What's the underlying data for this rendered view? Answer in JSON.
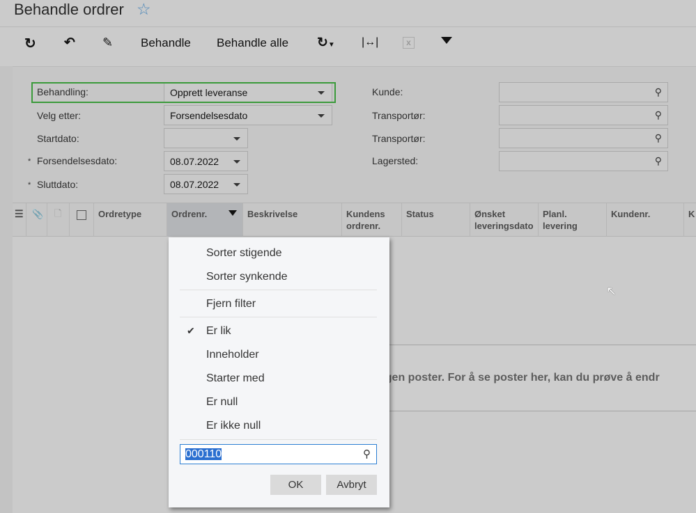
{
  "header": {
    "title": "Behandle ordrer",
    "favorite_icon": "star-outline-icon"
  },
  "toolbar": {
    "refresh_icon": "refresh-icon",
    "undo_icon": "undo-icon",
    "edit_icon": "pencil-icon",
    "process": "Behandle",
    "process_all": "Behandle alle",
    "schedule_icon": "clock-refresh-icon",
    "fit_icon": "fit-columns-icon",
    "export_icon": "excel-export-icon",
    "filter_icon": "filter-icon"
  },
  "form": {
    "behandling": {
      "label": "Behandling:",
      "value": "Opprett leveranse"
    },
    "velg_etter": {
      "label": "Velg etter:",
      "value": "Forsendelsesdato"
    },
    "startdato": {
      "label": "Startdato:",
      "value": ""
    },
    "forsendelsesdato": {
      "label": "Forsendelsesdato:",
      "value": "08.07.2022",
      "required": "*"
    },
    "sluttdato": {
      "label": "Sluttdato:",
      "value": "08.07.2022",
      "required": "*"
    },
    "kunde": {
      "label": "Kunde:",
      "value": ""
    },
    "transportor1": {
      "label": "Transportør:",
      "value": ""
    },
    "transportor2": {
      "label": "Transportør:",
      "value": ""
    },
    "lagersted": {
      "label": "Lagersted:",
      "value": ""
    }
  },
  "grid": {
    "columns": [
      "Ordretype",
      "Ordrenr.",
      "Beskrivelse",
      "Kundens ordrenr.",
      "Status",
      "Ønsket leveringsdato",
      "Planl. levering",
      "Kundenr.",
      "K"
    ],
    "empty_message": "ngen poster. For å se poster her, kan du prøve å endr"
  },
  "filter_popup": {
    "sort_asc": "Sorter stigende",
    "sort_desc": "Sorter synkende",
    "clear": "Fjern filter",
    "conditions": [
      "Er lik",
      "Inneholder",
      "Starter med",
      "Er null",
      "Er ikke null"
    ],
    "selected_condition": "Er lik",
    "value": "000110",
    "ok": "OK",
    "cancel": "Avbryt"
  }
}
